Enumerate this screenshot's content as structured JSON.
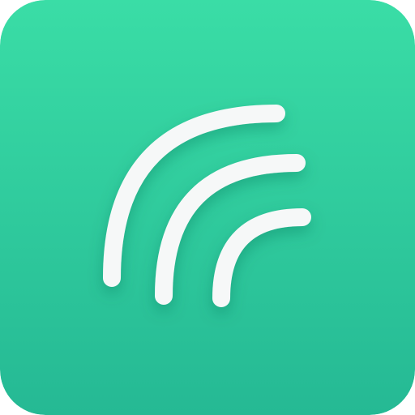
{
  "app_icon": {
    "glyph": "signal-waves-icon",
    "colors": {
      "gradient_top": "#3ADDA6",
      "gradient_bottom": "#25B994",
      "arc": "#F6F8F8",
      "shadow": "#0E6F55"
    }
  }
}
